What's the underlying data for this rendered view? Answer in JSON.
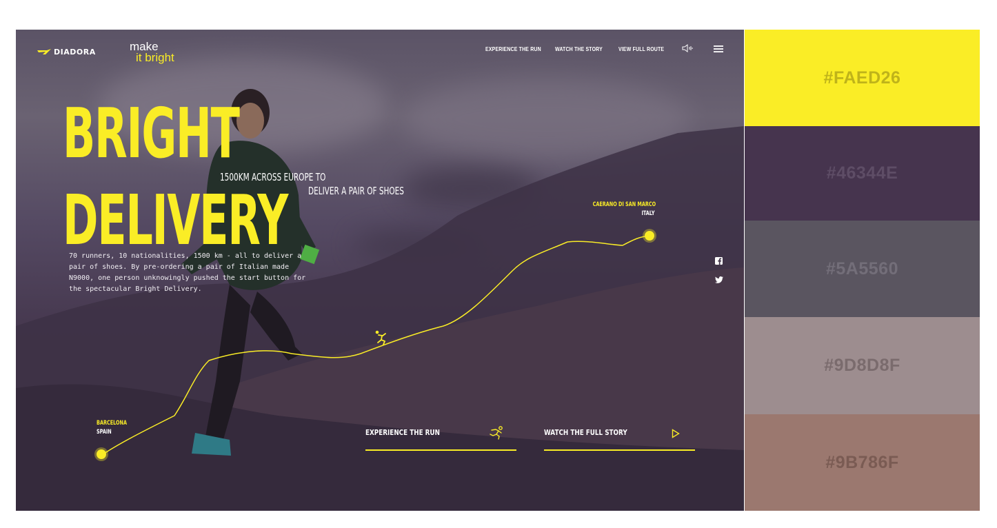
{
  "brand": {
    "name": "DIADORA",
    "tagline_top": "make",
    "tagline_bottom": "it bright"
  },
  "nav": {
    "items": [
      "EXPERIENCE THE RUN",
      "WATCH THE STORY",
      "VIEW FULL ROUTE"
    ],
    "sound_icon": "speaker-icon",
    "menu_icon": "hamburger-icon"
  },
  "hero": {
    "title_line1": "BRIGHT",
    "title_line2": "DELIVERY",
    "subtitle_line1": "1500KM ACROSS EUROPE TO",
    "subtitle_line2": "DELIVER A PAIR OF SHOES",
    "body": "70 runners, 10 nationalities, 1500 km - all to deliver a pair of shoes. By pre-ordering a pair of Italian made N9000, one person unknowingly pushed the start button for the spectacular Bright Delivery."
  },
  "route": {
    "start": {
      "city": "BARCELONA",
      "country": "SPAIN"
    },
    "end": {
      "city": "CAERANO DI SAN MARCO",
      "country": "ITALY"
    },
    "runner_icon": "runner-icon"
  },
  "social": {
    "icons": [
      "facebook-icon",
      "twitter-icon"
    ]
  },
  "ctas": {
    "experience": {
      "label": "EXPERIENCE THE RUN",
      "icon": "runner-icon"
    },
    "story": {
      "label": "WATCH THE FULL STORY",
      "icon": "play-icon"
    }
  },
  "palette": [
    {
      "label": "#FAED26",
      "color": "#FAED26",
      "text_color": "#bfb31a"
    },
    {
      "label": "#46344E",
      "color": "#46344E",
      "text_color": "#5e4d66"
    },
    {
      "label": "#5A5560",
      "color": "#5A5560",
      "text_color": "#736e79"
    },
    {
      "label": "#9D8D8F",
      "color": "#9D8D8F",
      "text_color": "#7a6b6d"
    },
    {
      "label": "#9B786F",
      "color": "#9B786F",
      "text_color": "#7a5b53"
    }
  ],
  "colors": {
    "accent": "#FAED26",
    "text": "#ffffff"
  }
}
